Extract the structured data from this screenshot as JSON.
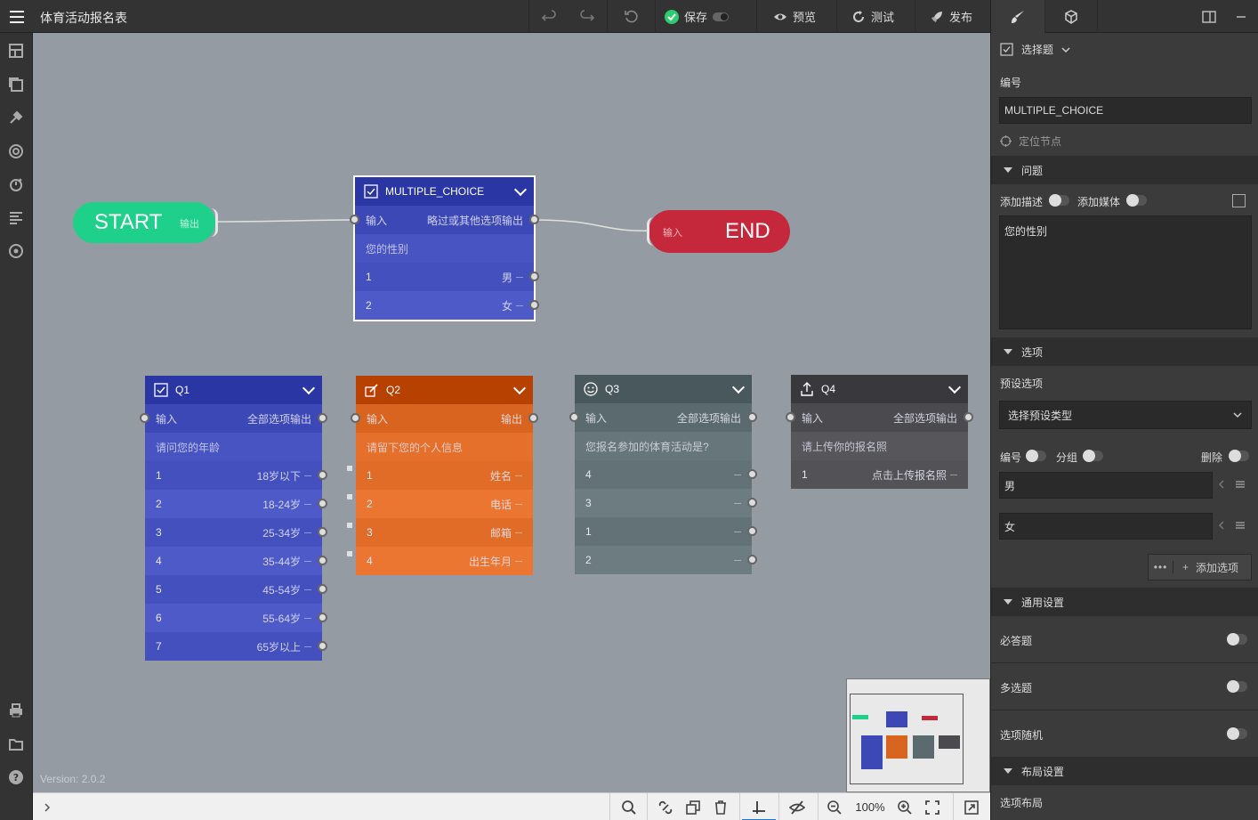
{
  "app": {
    "title": "体育活动报名表",
    "version": "Version: 2.0.2"
  },
  "toolbar": {
    "save": "保存",
    "preview": "预览",
    "test": "测试",
    "publish": "发布"
  },
  "canvas": {
    "start": {
      "label": "START",
      "port": "输出"
    },
    "end": {
      "label": "END",
      "port": "输入"
    },
    "nodes": [
      {
        "id": "MULTIPLE_CHOICE",
        "title": "MULTIPLE_CHOICE",
        "icon": "checkbox-icon",
        "color": "#3d48b7",
        "in": "输入",
        "out": "略过或其他选项输出",
        "question": "您的性别",
        "options": [
          {
            "n": "1",
            "label": "男"
          },
          {
            "n": "2",
            "label": "女"
          }
        ]
      },
      {
        "id": "Q1",
        "title": "Q1",
        "icon": "checkbox-icon",
        "color": "#3d48b7",
        "in": "输入",
        "out": "全部选项输出",
        "question": "请问您的年龄",
        "options": [
          {
            "n": "1",
            "label": "18岁以下"
          },
          {
            "n": "2",
            "label": "18-24岁"
          },
          {
            "n": "3",
            "label": "25-34岁"
          },
          {
            "n": "4",
            "label": "35-44岁"
          },
          {
            "n": "5",
            "label": "45-54岁"
          },
          {
            "n": "6",
            "label": "55-64岁"
          },
          {
            "n": "7",
            "label": "65岁以上"
          }
        ]
      },
      {
        "id": "Q2",
        "title": "Q2",
        "icon": "edit-icon",
        "color": "#d9641f",
        "in": "输入",
        "out": "输出",
        "question": "请留下您的个人信息",
        "options": [
          {
            "n": "1",
            "label": "姓名"
          },
          {
            "n": "2",
            "label": "电话"
          },
          {
            "n": "3",
            "label": "邮箱"
          },
          {
            "n": "4",
            "label": "出生年月"
          }
        ]
      },
      {
        "id": "Q3",
        "title": "Q3",
        "icon": "smile-icon",
        "color": "#5b6a6e",
        "in": "输入",
        "out": "全部选项输出",
        "question": "您报名参加的体育活动是?",
        "options": [
          {
            "n": "4",
            "label": ""
          },
          {
            "n": "3",
            "label": ""
          },
          {
            "n": "1",
            "label": ""
          },
          {
            "n": "2",
            "label": ""
          }
        ]
      },
      {
        "id": "Q4",
        "title": "Q4",
        "icon": "upload-icon",
        "color": "#4a4a4f",
        "in": "输入",
        "out": "全部选项输出",
        "question": "请上传你的报名照",
        "options": [
          {
            "n": "1",
            "label": "点击上传报名照"
          }
        ]
      }
    ]
  },
  "panel": {
    "type": "选择题",
    "id_label": "编号",
    "id_value": "MULTIPLE_CHOICE",
    "locate": "定位节点",
    "sec_question": "问题",
    "add_desc": "添加描述",
    "add_media": "添加媒体",
    "question_text": "您的性别",
    "sec_options": "选项",
    "preset_label": "预设选项",
    "preset_placeholder": "选择预设类型",
    "opt_number": "编号",
    "opt_group": "分组",
    "opt_delete": "删除",
    "options": [
      "男",
      "女"
    ],
    "add_option": "添加选项",
    "sec_general": "通用设置",
    "required": "必答题",
    "multi": "多选题",
    "random": "选项随机",
    "sec_layout": "布局设置",
    "option_layout": "选项布局"
  },
  "bottom": {
    "zoom": "100%"
  }
}
